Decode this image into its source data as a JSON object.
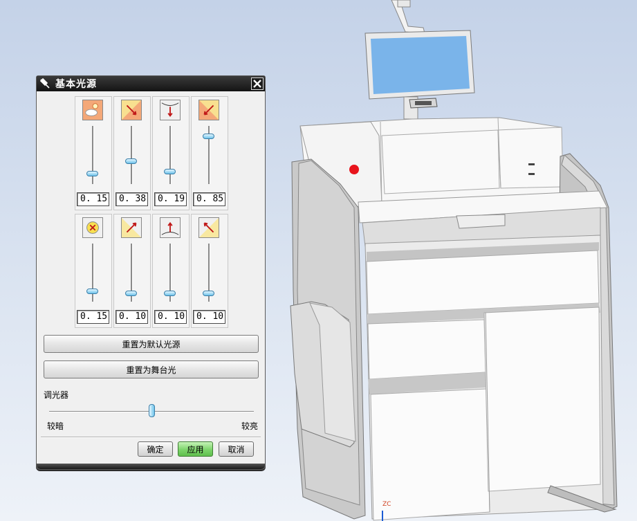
{
  "dialog": {
    "title": "基本光源",
    "lights_row1": [
      {
        "icon": "ambient-light-icon",
        "value": "0. 15(",
        "level": 0.15
      },
      {
        "icon": "top-left-light-icon",
        "value": "0. 38(",
        "level": 0.38
      },
      {
        "icon": "top-light-icon",
        "value": "0. 19(",
        "level": 0.19
      },
      {
        "icon": "top-right-light-icon",
        "value": "0. 85(",
        "level": 0.85
      }
    ],
    "lights_row2": [
      {
        "icon": "front-light-icon",
        "value": "0. 15(",
        "level": 0.15
      },
      {
        "icon": "bottom-left-light-icon",
        "value": "0. 10(",
        "level": 0.1
      },
      {
        "icon": "bottom-light-icon",
        "value": "0. 10(",
        "level": 0.1
      },
      {
        "icon": "bottom-right-light-icon",
        "value": "0. 10(",
        "level": 0.1
      }
    ],
    "reset_default_label": "重置为默认光源",
    "reset_stage_label": "重置为舞台光",
    "dimmer": {
      "label": "调光器",
      "min_label": "较暗",
      "max_label": "较亮",
      "level": 0.5
    },
    "ok_label": "确定",
    "apply_label": "应用",
    "cancel_label": "取消"
  },
  "viewport": {
    "axis_label": "ZC",
    "background_top": "#c4d2e8",
    "indicator_color": "#e8141c",
    "monitor_screen_color": "#7ab4ea"
  }
}
